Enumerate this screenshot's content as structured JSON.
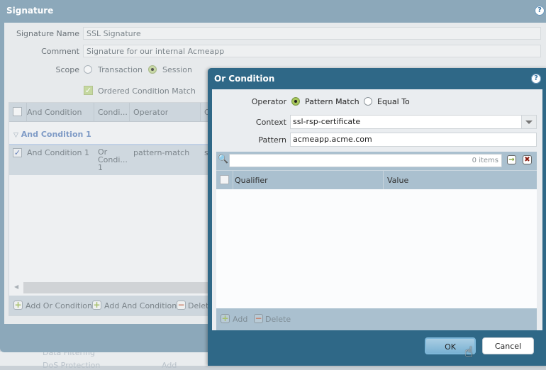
{
  "background": {
    "items": [
      "Data Filtering",
      "DoS Protection"
    ],
    "add_label": "Add"
  },
  "signature_dialog": {
    "title": "Signature",
    "help_icon": "?",
    "fields": {
      "signature_name_label": "Signature Name",
      "signature_name_value": "SSL Signature",
      "comment_label": "Comment",
      "comment_value": "Signature for our internal Acmeapp",
      "scope_label": "Scope",
      "scope_options": [
        "Transaction",
        "Session"
      ],
      "scope_selected": "Session",
      "ordered_match_label": "Ordered Condition Match",
      "ordered_match_checked": true
    },
    "grid": {
      "columns": [
        "And Condition",
        "Condi...",
        "Operator",
        "C"
      ],
      "group_label": "And Condition 1",
      "rows": [
        {
          "and_condition": "And Condition 1",
          "condition": "Or Condi... 1",
          "condition_lines": [
            "Or",
            "Condi...",
            "1"
          ],
          "operator": "pattern-match",
          "context": "s",
          "checked": true
        }
      ],
      "footer": {
        "add_or": "Add Or Condition",
        "add_and": "Add And Condition",
        "delete": "Delete"
      }
    }
  },
  "or_condition_dialog": {
    "title": "Or Condition",
    "help_icon": "?",
    "operator_label": "Operator",
    "operator_options": [
      "Pattern Match",
      "Equal To"
    ],
    "operator_selected": "Pattern Match",
    "context_label": "Context",
    "context_value": "ssl-rsp-certificate",
    "pattern_label": "Pattern",
    "pattern_value": "acmeapp.acme.com",
    "qualifier_grid": {
      "search_value": "",
      "item_count": "0 items",
      "columns": [
        "Qualifier",
        "Value"
      ],
      "rows": [],
      "footer": {
        "add": "Add",
        "delete": "Delete"
      }
    },
    "buttons": {
      "ok": "OK",
      "cancel": "Cancel"
    }
  }
}
